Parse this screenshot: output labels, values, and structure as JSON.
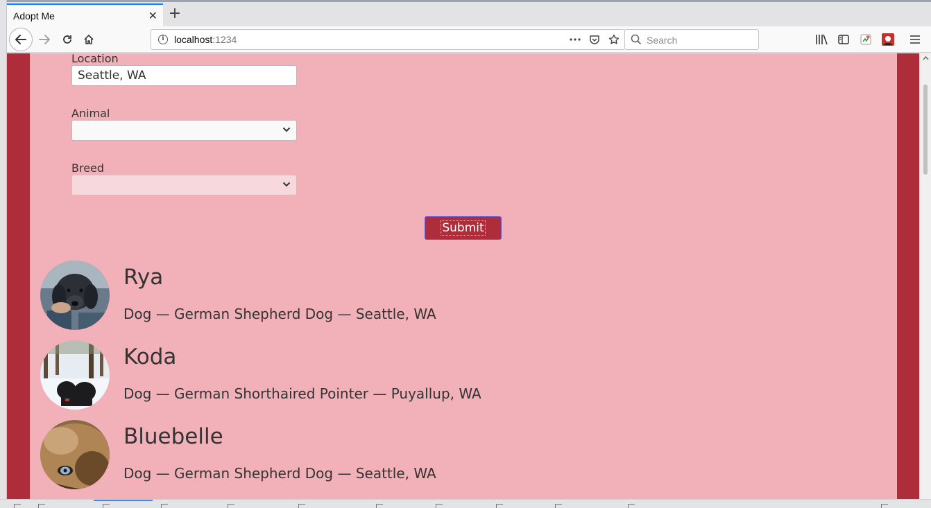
{
  "browser": {
    "tab_title": "Adopt Me",
    "tab_close_glyph": "✕",
    "new_tab_glyph": "+",
    "url_host": "localhost",
    "url_port": ":1234",
    "search_placeholder": "Search",
    "icons": [
      "back-arrow-icon",
      "forward-arrow-icon",
      "reload-icon",
      "home-icon",
      "info-icon",
      "more-actions-icon",
      "pocket-icon",
      "bookmark-star-icon",
      "search-icon",
      "library-icon",
      "sidebar-icon",
      "extension-icon",
      "profile-icon",
      "hamburger-menu-icon"
    ]
  },
  "form": {
    "location_label": "Location",
    "location_value": "Seattle, WA",
    "animal_label": "Animal",
    "animal_value": "",
    "breed_label": "Breed",
    "breed_value": "",
    "submit_label": "Submit"
  },
  "pets": [
    {
      "name": "Rya",
      "details": "Dog — German Shepherd Dog — Seattle, WA"
    },
    {
      "name": "Koda",
      "details": "Dog — German Shorthaired Pointer — Puyallup, WA"
    },
    {
      "name": "Bluebelle",
      "details": "Dog — German Shepherd Dog — Seattle, WA"
    }
  ],
  "colors": {
    "page_border": "#ad2d3a",
    "content_bg": "#f2b0b9",
    "submit_bg": "#ad2d3a",
    "text": "#333333"
  }
}
